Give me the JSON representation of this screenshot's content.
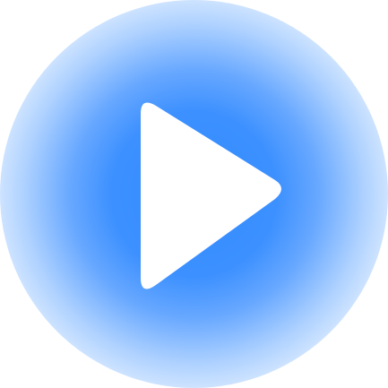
{
  "player": {
    "control": "play-button",
    "icon": "play-icon",
    "glow_color": "#3C90FF",
    "icon_color": "#FFFFFF"
  }
}
